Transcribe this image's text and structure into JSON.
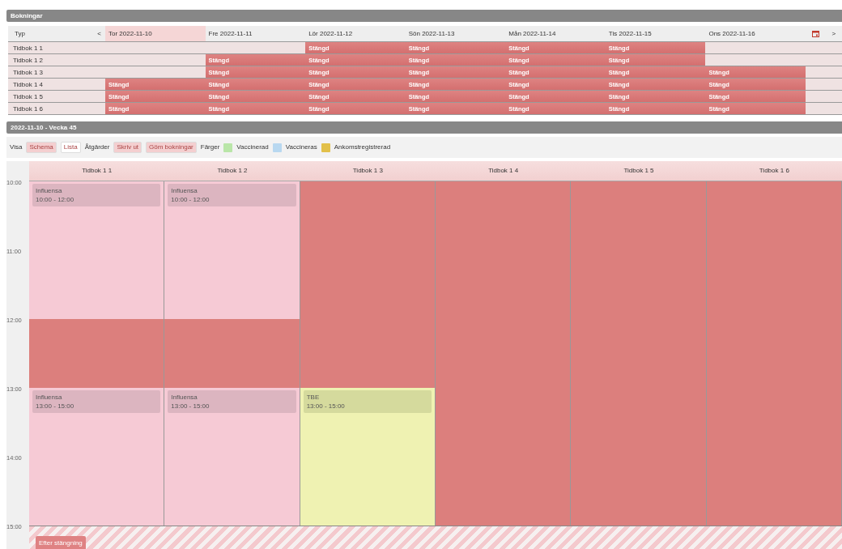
{
  "bookings_panel": {
    "title": "Bokningar",
    "type_label": "Typ",
    "prev": "<",
    "next": ">",
    "days": [
      {
        "label": "Tor 2022-11-10",
        "selected": true
      },
      {
        "label": "Fre 2022-11-11",
        "selected": false
      },
      {
        "label": "Lör 2022-11-12",
        "selected": false
      },
      {
        "label": "Sön 2022-11-13",
        "selected": false
      },
      {
        "label": "Mån 2022-11-14",
        "selected": false
      },
      {
        "label": "Tis 2022-11-15",
        "selected": false
      },
      {
        "label": "Ons 2022-11-16",
        "selected": false
      }
    ],
    "rows": [
      {
        "name": "Tidbok 1 1",
        "cells": [
          {
            "closed": false
          },
          {
            "closed": false
          },
          {
            "closed": true,
            "text": "Stängd"
          },
          {
            "closed": true,
            "text": "Stängd"
          },
          {
            "closed": true,
            "text": "Stängd"
          },
          {
            "closed": true,
            "text": "Stängd"
          },
          {
            "closed": false
          }
        ]
      },
      {
        "name": "Tidbok 1 2",
        "cells": [
          {
            "closed": false
          },
          {
            "closed": true,
            "text": "Stängd"
          },
          {
            "closed": true,
            "text": "Stängd"
          },
          {
            "closed": true,
            "text": "Stängd"
          },
          {
            "closed": true,
            "text": "Stängd"
          },
          {
            "closed": true,
            "text": "Stängd"
          },
          {
            "closed": false
          }
        ]
      },
      {
        "name": "Tidbok 1 3",
        "cells": [
          {
            "closed": false
          },
          {
            "closed": true,
            "text": "Stängd"
          },
          {
            "closed": true,
            "text": "Stängd"
          },
          {
            "closed": true,
            "text": "Stängd"
          },
          {
            "closed": true,
            "text": "Stängd"
          },
          {
            "closed": true,
            "text": "Stängd"
          },
          {
            "closed": true,
            "text": "Stängd"
          }
        ]
      },
      {
        "name": "Tidbok 1 4",
        "cells": [
          {
            "closed": true,
            "text": "Stängd"
          },
          {
            "closed": true,
            "text": "Stängd"
          },
          {
            "closed": true,
            "text": "Stängd"
          },
          {
            "closed": true,
            "text": "Stängd"
          },
          {
            "closed": true,
            "text": "Stängd"
          },
          {
            "closed": true,
            "text": "Stängd"
          },
          {
            "closed": true,
            "text": "Stängd"
          }
        ]
      },
      {
        "name": "Tidbok 1 5",
        "cells": [
          {
            "closed": true,
            "text": "Stängd"
          },
          {
            "closed": true,
            "text": "Stängd"
          },
          {
            "closed": true,
            "text": "Stängd"
          },
          {
            "closed": true,
            "text": "Stängd"
          },
          {
            "closed": true,
            "text": "Stängd"
          },
          {
            "closed": true,
            "text": "Stängd"
          },
          {
            "closed": true,
            "text": "Stängd"
          }
        ]
      },
      {
        "name": "Tidbok 1 6",
        "cells": [
          {
            "closed": true,
            "text": "Stängd"
          },
          {
            "closed": true,
            "text": "Stängd"
          },
          {
            "closed": true,
            "text": "Stängd"
          },
          {
            "closed": true,
            "text": "Stängd"
          },
          {
            "closed": true,
            "text": "Stängd"
          },
          {
            "closed": true,
            "text": "Stängd"
          },
          {
            "closed": true,
            "text": "Stängd"
          }
        ]
      }
    ]
  },
  "day_panel": {
    "title": "2022-11-10 - Vecka 45",
    "toolbar": {
      "view_label": "Visa",
      "views": [
        {
          "label": "Schema",
          "selected": true
        },
        {
          "label": "Lista",
          "selected": false
        }
      ],
      "actions_label": "Åtgärder",
      "actions": [
        "Skriv ut",
        "Göm bokningar"
      ],
      "colors_label": "Färger",
      "legend": [
        {
          "label": "Vaccinerad",
          "color": "#b9e6a8"
        },
        {
          "label": "Vaccineras",
          "color": "#b8d8f0"
        },
        {
          "label": "Ankomstregistrerad",
          "color": "#e2c04a"
        }
      ]
    },
    "hours": [
      "10:00",
      "11:00",
      "12:00",
      "13:00",
      "14:00",
      "15:00"
    ],
    "columns": [
      {
        "name": "Tidbok 1 1",
        "slots": [
          {
            "kind": "open",
            "event": {
              "title": "Influensa",
              "time": "10:00 - 12:00"
            }
          },
          {
            "kind": "open"
          },
          {
            "kind": "closed"
          },
          {
            "kind": "open",
            "event": {
              "title": "Influensa",
              "time": "13:00 - 15:00"
            }
          },
          {
            "kind": "open"
          }
        ]
      },
      {
        "name": "Tidbok 1 2",
        "slots": [
          {
            "kind": "open",
            "event": {
              "title": "Influensa",
              "time": "10:00 - 12:00"
            }
          },
          {
            "kind": "open"
          },
          {
            "kind": "closed"
          },
          {
            "kind": "open",
            "event": {
              "title": "Influensa",
              "time": "13:00 - 15:00"
            }
          },
          {
            "kind": "open"
          }
        ]
      },
      {
        "name": "Tidbok 1 3",
        "slots": [
          {
            "kind": "closed"
          },
          {
            "kind": "closed"
          },
          {
            "kind": "closed"
          },
          {
            "kind": "booked",
            "event": {
              "title": "TBE",
              "time": "13:00 - 15:00"
            }
          },
          {
            "kind": "booked"
          }
        ]
      },
      {
        "name": "Tidbok 1 4",
        "slots": [
          {
            "kind": "closed"
          },
          {
            "kind": "closed"
          },
          {
            "kind": "closed"
          },
          {
            "kind": "closed"
          },
          {
            "kind": "closed"
          }
        ]
      },
      {
        "name": "Tidbok 1 5",
        "slots": [
          {
            "kind": "closed"
          },
          {
            "kind": "closed"
          },
          {
            "kind": "closed"
          },
          {
            "kind": "closed"
          },
          {
            "kind": "closed"
          }
        ]
      },
      {
        "name": "Tidbok 1 6",
        "slots": [
          {
            "kind": "closed"
          },
          {
            "kind": "closed"
          },
          {
            "kind": "closed"
          },
          {
            "kind": "closed"
          },
          {
            "kind": "closed"
          }
        ]
      }
    ],
    "after_closing": "Efter stängning"
  }
}
